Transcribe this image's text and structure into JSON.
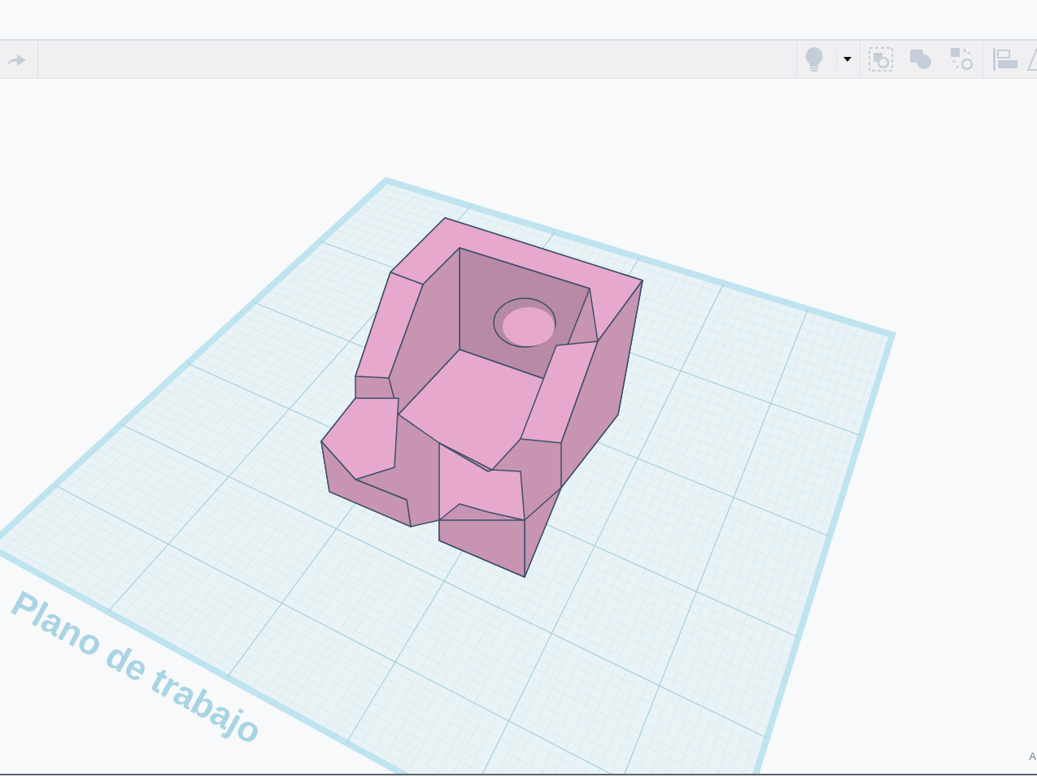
{
  "workplane": {
    "label": "Plano de trabajo"
  },
  "corner_text": "A"
}
